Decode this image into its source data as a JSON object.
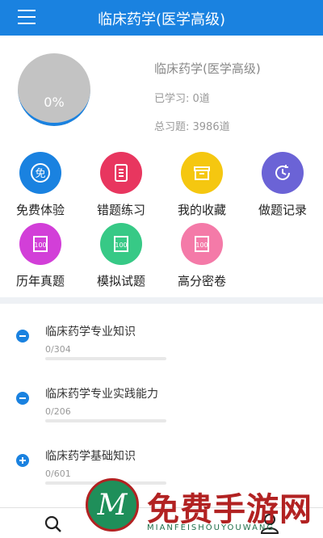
{
  "header": {
    "title": "临床药学(医学高级)"
  },
  "summary": {
    "progress_label": "0%",
    "progress": 0,
    "title": "临床药学(医学高级)",
    "learned": "已学习: 0道",
    "total": "总习题: 3986道"
  },
  "grid": {
    "free_trial": "免费体验",
    "wrong_practice": "错题练习",
    "favorites": "我的收藏",
    "records": "做题记录",
    "past_exams": "历年真题",
    "mock_exams": "模拟试题",
    "high_score": "高分密卷"
  },
  "chapters": [
    {
      "name": "临床药学专业知识",
      "count": "0/304",
      "expanded": true
    },
    {
      "name": "临床药学专业实践能力",
      "count": "0/206",
      "expanded": true
    },
    {
      "name": "临床药学基础知识",
      "count": "0/601",
      "expanded": false
    }
  ],
  "watermark": {
    "text": "免费手游网",
    "sub": "MIANFEISHOUYOUWANG"
  },
  "colors": {
    "primary": "#1a82e0",
    "background": "#ffffff"
  }
}
